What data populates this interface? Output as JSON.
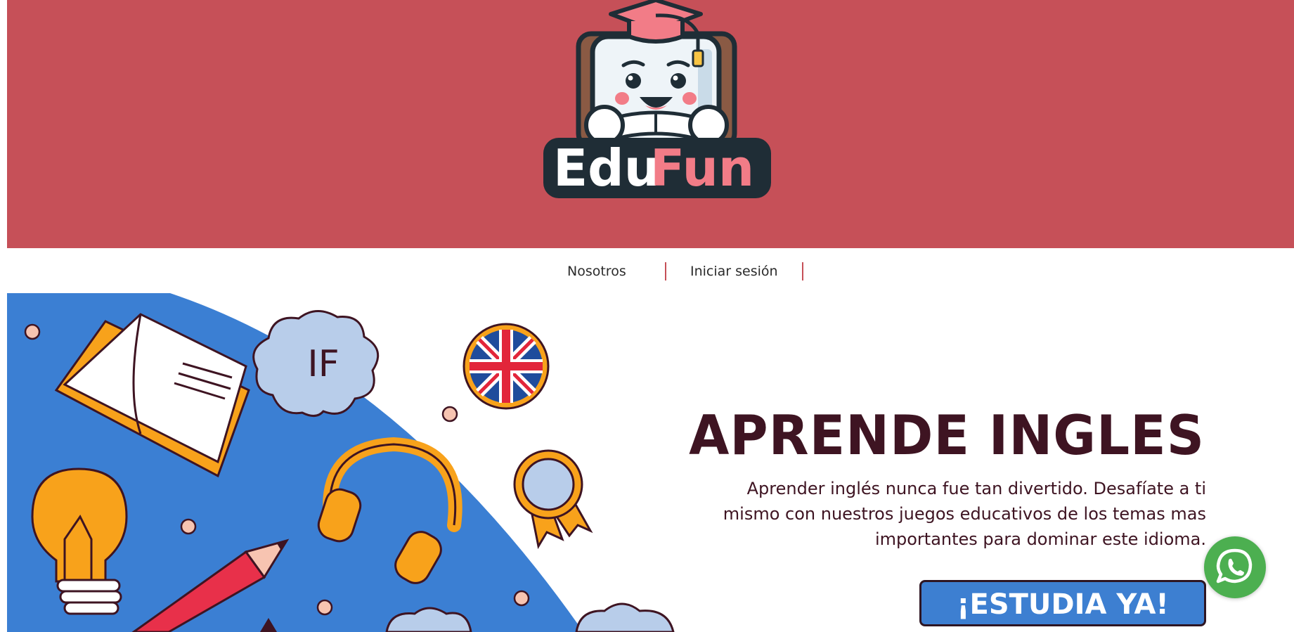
{
  "brand": {
    "logo_text_part1": "Edu",
    "logo_text_part2": "Fun",
    "header_color": "#c65058",
    "logo_accent": "#f27c87",
    "logo_outline": "#1f2d36"
  },
  "nav": {
    "items": [
      {
        "label": "Nosotros"
      },
      {
        "label": "Iniciar sesión"
      }
    ],
    "separator_color": "#c65058"
  },
  "hero": {
    "title": "APRENDE INGLES",
    "description": "Aprender inglés nunca fue tan divertido. Desafíate a ti mismo con nuestros juegos educativos de los temas mas importantes para dominar este idioma.",
    "cta_label": "¡ESTUDIA YA!",
    "cloud_text": "IF",
    "title_color": "#3e1422",
    "art_blue": "#3b7fd3",
    "art_orange": "#f8a21b"
  },
  "whatsapp": {
    "icon": "whatsapp-icon",
    "color": "#4caf50"
  }
}
